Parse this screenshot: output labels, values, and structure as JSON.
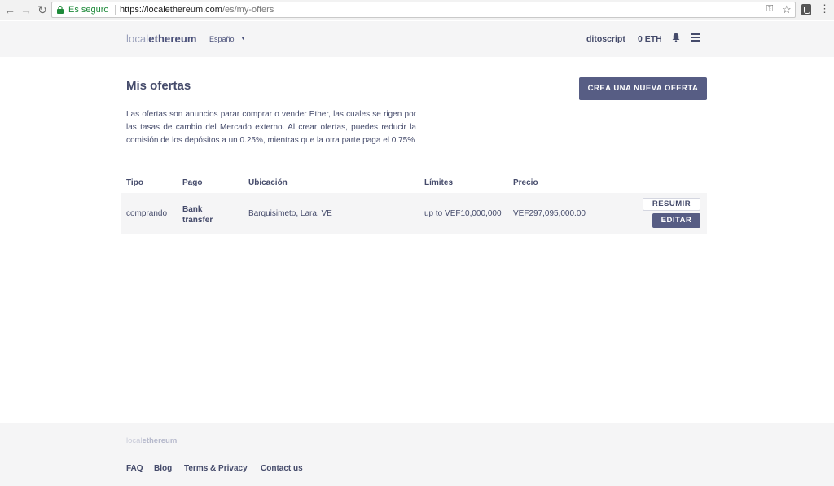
{
  "browser": {
    "secure_label": "Es seguro",
    "url_host": "https://localethereum.com",
    "url_path": "/es/my-offers"
  },
  "header": {
    "logo_light": "local",
    "logo_bold": "ethereum",
    "language": "Español",
    "username": "ditoscript",
    "balance": "0 ETH"
  },
  "main": {
    "title": "Mis ofertas",
    "create_button": "CREA UNA NUEVA OFERTA",
    "description": "Las ofertas son anuncios parar comprar o vender Ether, las cuales se rigen por las tasas de cambio del Mercado externo. Al crear ofertas, puedes reducir la comisión de los depósitos a un 0.25%, mientras que la otra parte paga el 0.75%"
  },
  "table": {
    "headers": {
      "type": "Tipo",
      "payment": "Pago",
      "location": "Ubicación",
      "limits": "Límites",
      "price": "Precio"
    },
    "rows": [
      {
        "type": "comprando",
        "payment": "Bank transfer",
        "location": "Barquisimeto, Lara, VE",
        "limits": "up to VEF10,000,000",
        "price": "VEF297,095,000.00",
        "resume_label": "RESUMIR",
        "edit_label": "EDITAR"
      }
    ]
  },
  "footer": {
    "logo_light": "local",
    "logo_bold": "ethereum",
    "links": [
      "FAQ",
      "Blog",
      "Terms & Privacy",
      "Contact us"
    ]
  },
  "colors": {
    "accent": "#575d84",
    "text": "#454b6b",
    "header_bg": "#f5f5f6",
    "secure_green": "#1e8a3a"
  },
  "icons": [
    "back-arrow-icon",
    "forward-arrow-icon",
    "reload-icon",
    "lock-icon",
    "key-icon",
    "star-icon",
    "extension-icon",
    "chrome-menu-icon",
    "caret-down-icon",
    "bell-icon",
    "hamburger-menu-icon"
  ]
}
